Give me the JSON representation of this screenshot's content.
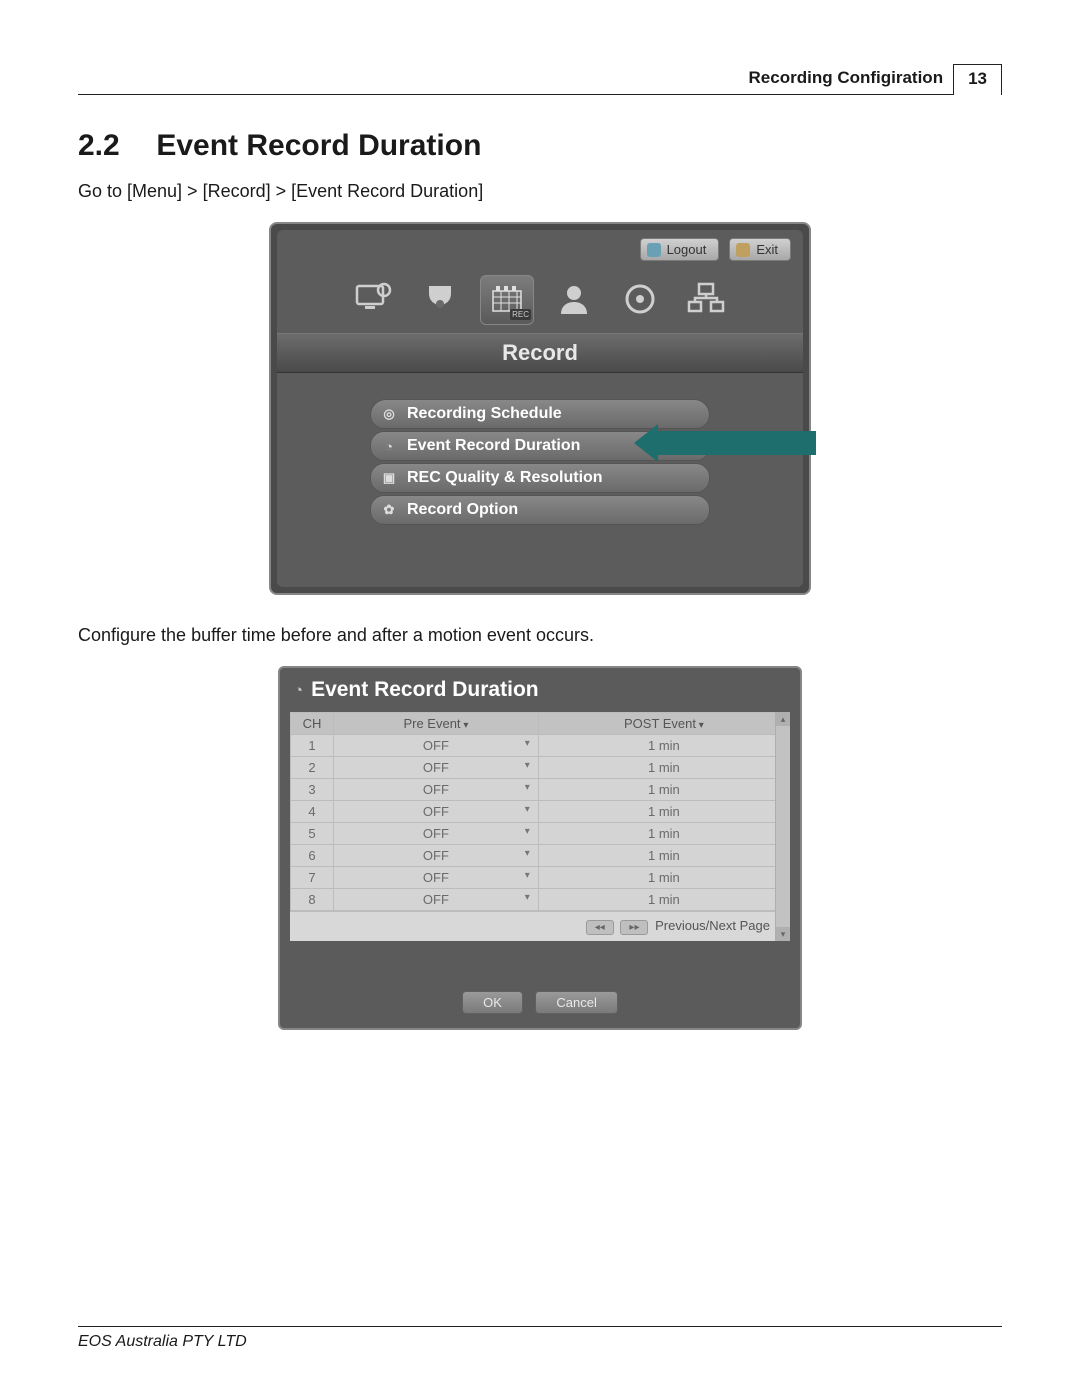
{
  "header": {
    "running_title": "Recording Configiration",
    "page_number": "13"
  },
  "section": {
    "number": "2.2",
    "title": "Event Record Duration"
  },
  "intro": "Go to [Menu] > [Record] > [Event Record Duration]",
  "after_note": "Configure the buffer time before and after a motion event occurs.",
  "footer": "EOS Australia PTY LTD",
  "menu": {
    "topbar": {
      "logout": "Logout",
      "exit": "Exit"
    },
    "icons": [
      "display-settings",
      "camera",
      "record",
      "user",
      "disc",
      "network"
    ],
    "selected_tab": "Record",
    "items": [
      {
        "icon": "target-icon",
        "label": "Recording Schedule"
      },
      {
        "icon": "clock-icon",
        "label": "Event Record Duration"
      },
      {
        "icon": "picture-icon",
        "label": "REC Quality & Resolution"
      },
      {
        "icon": "gear-icon",
        "label": "Record Option"
      }
    ],
    "arrow_points_to_index": 1
  },
  "dialog": {
    "title": "Event Record Duration",
    "columns": {
      "ch": "CH",
      "pre": "Pre Event",
      "post": "POST Event"
    },
    "rows": [
      {
        "ch": "1",
        "pre": "OFF",
        "post": "1 min"
      },
      {
        "ch": "2",
        "pre": "OFF",
        "post": "1 min"
      },
      {
        "ch": "3",
        "pre": "OFF",
        "post": "1 min"
      },
      {
        "ch": "4",
        "pre": "OFF",
        "post": "1 min"
      },
      {
        "ch": "5",
        "pre": "OFF",
        "post": "1 min"
      },
      {
        "ch": "6",
        "pre": "OFF",
        "post": "1 min"
      },
      {
        "ch": "7",
        "pre": "OFF",
        "post": "1 min"
      },
      {
        "ch": "8",
        "pre": "OFF",
        "post": "1 min"
      }
    ],
    "pager_label": "Previous/Next Page",
    "ok": "OK",
    "cancel": "Cancel"
  }
}
